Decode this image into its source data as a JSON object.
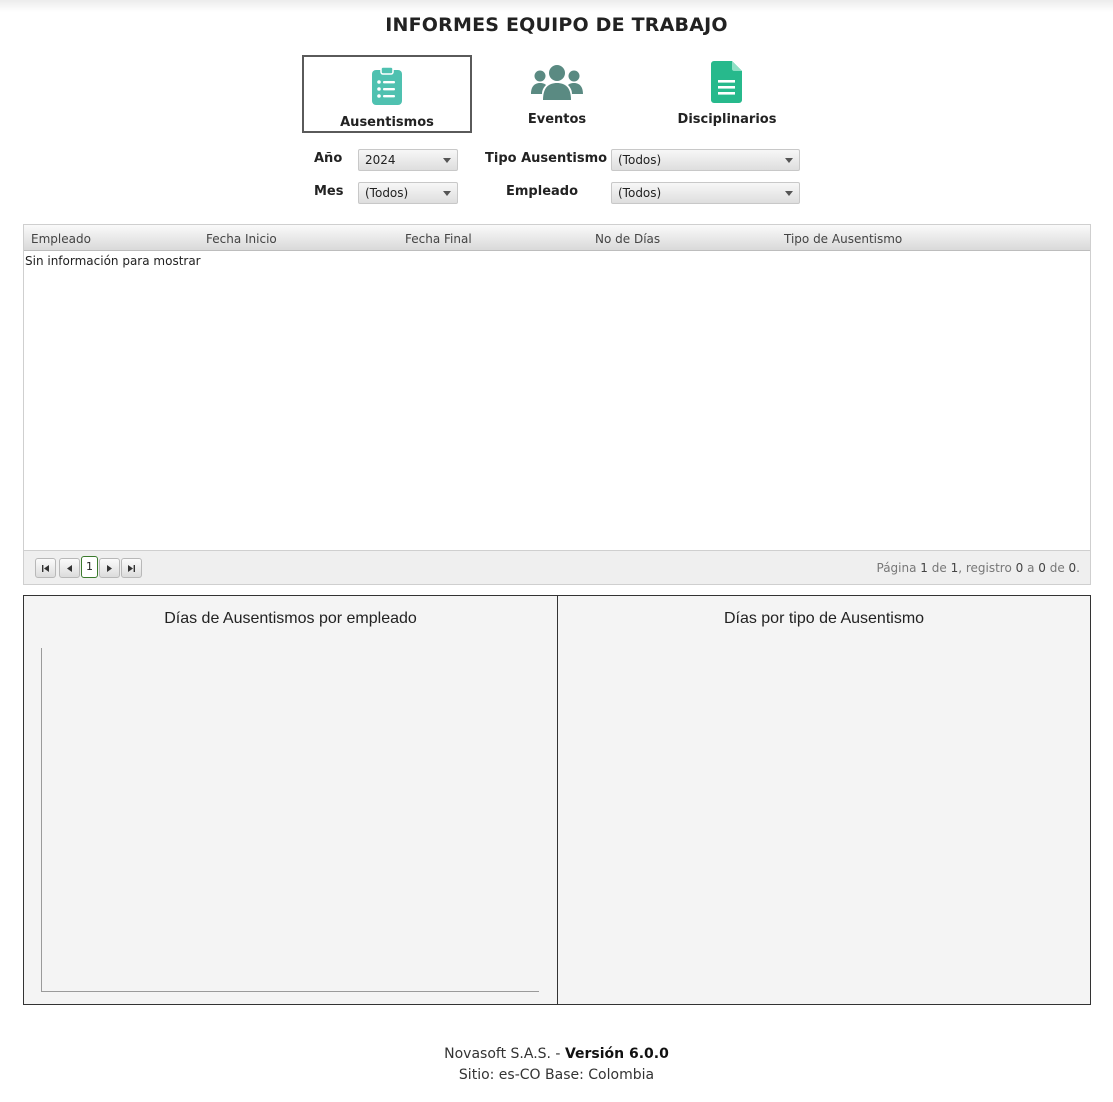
{
  "page": {
    "title": "INFORMES EQUIPO DE TRABAJO"
  },
  "tiles": [
    {
      "label": "Ausentismos",
      "icon": "clipboard-list-icon",
      "active": true
    },
    {
      "label": "Eventos",
      "icon": "users-icon",
      "active": false
    },
    {
      "label": "Disciplinarios",
      "icon": "document-icon",
      "active": false
    }
  ],
  "colors": {
    "accent": "#4fc1b0",
    "icon_gray": "#5a8a82",
    "doc_green": "#27b98c"
  },
  "filters": {
    "year_label": "Año",
    "year_value": "2024",
    "type_label": "Tipo Ausentismo",
    "type_value": "(Todos)",
    "month_label": "Mes",
    "month_value": "(Todos)",
    "employee_label": "Empleado",
    "employee_value": "(Todos)"
  },
  "grid": {
    "columns": [
      "Empleado",
      "Fecha Inicio",
      "Fecha Final",
      "No de Días",
      "Tipo de Ausentismo"
    ],
    "empty_message": "Sin información para mostrar",
    "pager": {
      "current_page": "1",
      "info_prefix": "Página ",
      "page": "1",
      "of": " de ",
      "pages": "1",
      "record_text": ", registro ",
      "from": "0",
      "to_text": " a ",
      "to": "0",
      "total_text": " de ",
      "total": "0",
      "end": "."
    }
  },
  "charts": {
    "left_title": "Días de Ausentismos por empleado",
    "right_title": "Días por tipo de Ausentismo"
  },
  "chart_data": [
    {
      "type": "bar",
      "title": "Días de Ausentismos por empleado",
      "categories": [],
      "values": [],
      "xlabel": "",
      "ylabel": ""
    },
    {
      "type": "pie",
      "title": "Días por tipo de Ausentismo",
      "categories": [],
      "values": []
    }
  ],
  "footer": {
    "company": "Novasoft S.A.S. - ",
    "version": "Versión 6.0.0",
    "site": "Sitio: es-CO Base: Colombia"
  }
}
